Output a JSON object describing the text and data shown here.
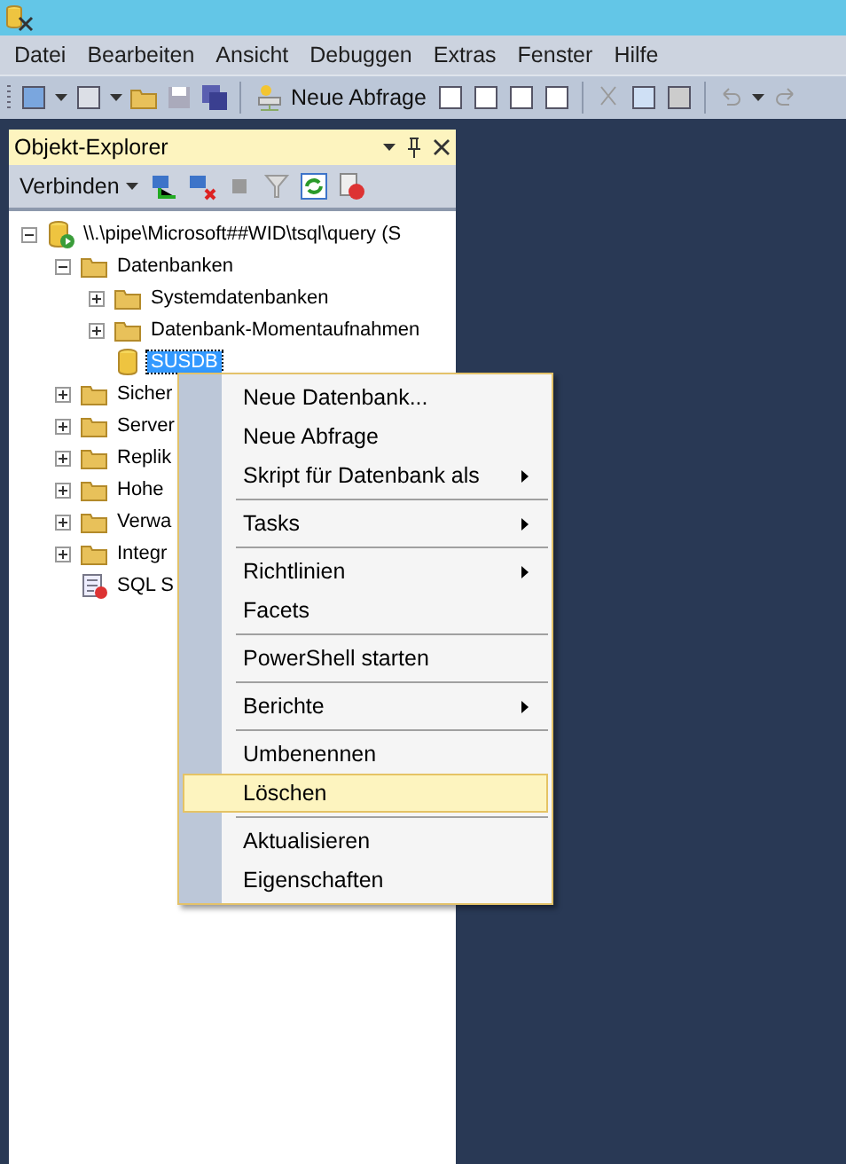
{
  "menu_bar": [
    "Datei",
    "Bearbeiten",
    "Ansicht",
    "Debuggen",
    "Extras",
    "Fenster",
    "Hilfe"
  ],
  "toolbar": {
    "new_query_label": "Neue Abfrage"
  },
  "object_explorer": {
    "title": "Objekt-Explorer",
    "connect_label": "Verbinden",
    "tree": [
      {
        "label": "\\\\.\\pipe\\Microsoft##WID\\tsql\\query (S",
        "kind": "server",
        "expanded": true,
        "selected": false,
        "children": [
          {
            "label": "Datenbanken",
            "kind": "folder",
            "expanded": true,
            "selected": false,
            "children": [
              {
                "label": "Systemdatenbanken",
                "kind": "folder",
                "expanded": false,
                "selected": false
              },
              {
                "label": "Datenbank-Momentaufnahmen",
                "kind": "folder",
                "expanded": false,
                "selected": false
              },
              {
                "label": "SUSDB",
                "kind": "database",
                "selected": true
              }
            ]
          },
          {
            "label": "Sicher",
            "kind": "folder",
            "expanded": false,
            "selected": false
          },
          {
            "label": "Server",
            "kind": "folder",
            "expanded": false,
            "selected": false
          },
          {
            "label": "Replik",
            "kind": "folder",
            "expanded": false,
            "selected": false
          },
          {
            "label": "Hohe",
            "kind": "folder",
            "expanded": false,
            "selected": false
          },
          {
            "label": "Verwa",
            "kind": "folder",
            "expanded": false,
            "selected": false
          },
          {
            "label": "Integr",
            "kind": "folder",
            "expanded": false,
            "selected": false
          },
          {
            "label": "SQL S",
            "kind": "agent",
            "selected": false
          }
        ]
      }
    ]
  },
  "context_menu": [
    {
      "kind": "item",
      "label": "Neue Datenbank...",
      "submenu": false,
      "selected": false
    },
    {
      "kind": "item",
      "label": "Neue Abfrage",
      "submenu": false,
      "selected": false
    },
    {
      "kind": "item",
      "label": "Skript für Datenbank als",
      "submenu": true,
      "selected": false
    },
    {
      "kind": "separator"
    },
    {
      "kind": "item",
      "label": "Tasks",
      "submenu": true,
      "selected": false
    },
    {
      "kind": "separator"
    },
    {
      "kind": "item",
      "label": "Richtlinien",
      "submenu": true,
      "selected": false
    },
    {
      "kind": "item",
      "label": "Facets",
      "submenu": false,
      "selected": false
    },
    {
      "kind": "separator"
    },
    {
      "kind": "item",
      "label": "PowerShell starten",
      "submenu": false,
      "selected": false
    },
    {
      "kind": "separator"
    },
    {
      "kind": "item",
      "label": "Berichte",
      "submenu": true,
      "selected": false
    },
    {
      "kind": "separator"
    },
    {
      "kind": "item",
      "label": "Umbenennen",
      "submenu": false,
      "selected": false
    },
    {
      "kind": "item",
      "label": "Löschen",
      "submenu": false,
      "selected": true
    },
    {
      "kind": "separator"
    },
    {
      "kind": "item",
      "label": "Aktualisieren",
      "submenu": false,
      "selected": false
    },
    {
      "kind": "item",
      "label": "Eigenschaften",
      "submenu": false,
      "selected": false
    }
  ]
}
